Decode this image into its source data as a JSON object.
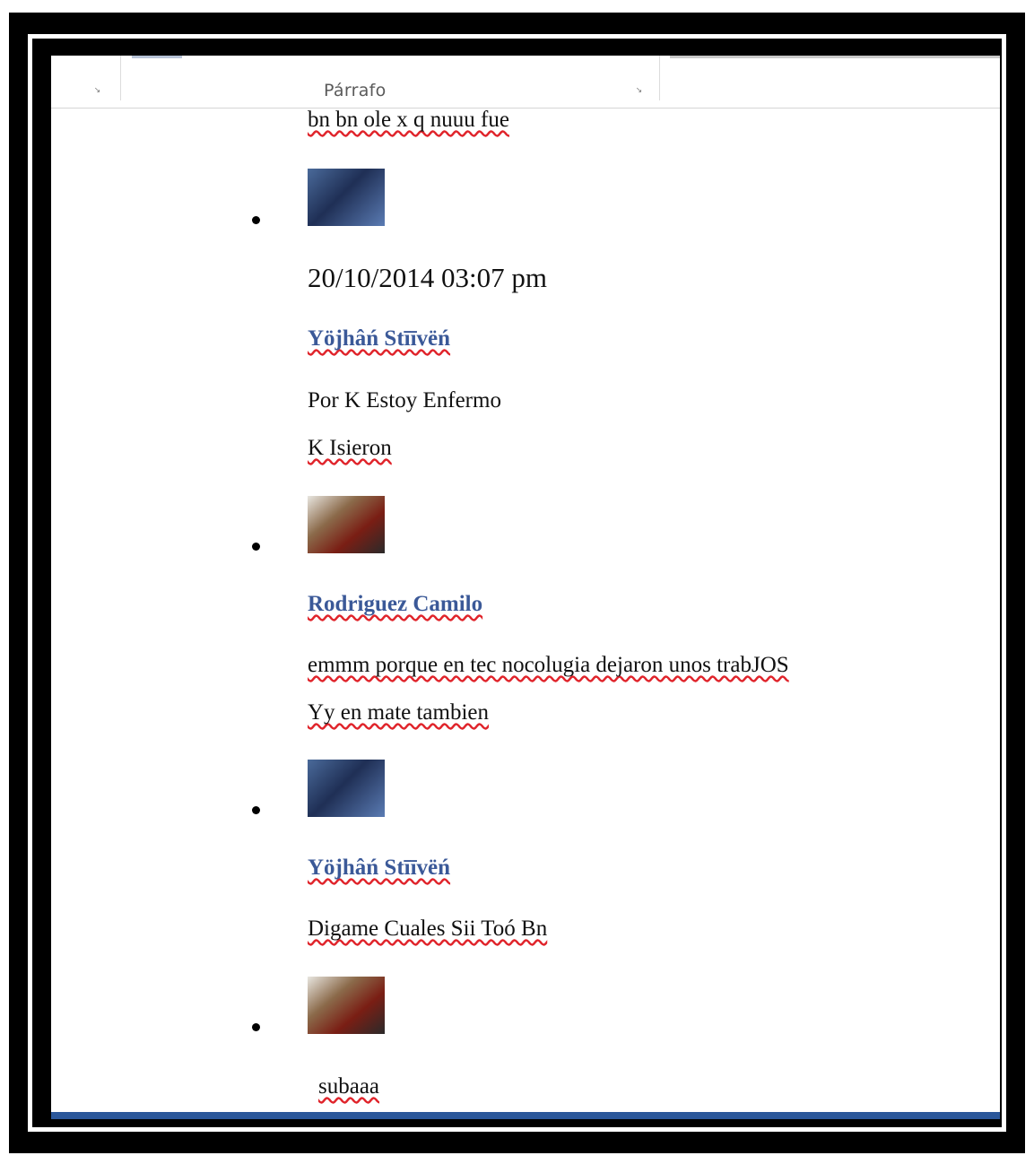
{
  "ribbon": {
    "group_label": "Párrafo"
  },
  "colors": {
    "name_link": "#3b5998",
    "spell_squiggle": "#e0242b",
    "status_bar": "#2b579a"
  },
  "comments": [
    {
      "text_lines": [
        "bn bn ole x q nuuu fue"
      ]
    },
    {
      "avatar": "user-photo-yojhan",
      "timestamp": "20/10/2014 03:07 pm",
      "author": "Yöjhâń Stīīvëń",
      "text_lines": [
        "Por K Estoy Enfermo",
        "K Isieron"
      ]
    },
    {
      "avatar": "user-photo-rodriguez",
      "author": "Rodriguez Camilo",
      "text_lines": [
        "emmm porque en tec nocolugia dejaron unos trabJOS",
        "Yy en mate tambien"
      ]
    },
    {
      "avatar": "user-photo-yojhan",
      "author": "Yöjhâń Stīīvëń",
      "text_lines": [
        "Digame Cuales Sii Toó Bn"
      ]
    },
    {
      "avatar": "user-photo-rodriguez",
      "text_lines": [
        "subaaa"
      ]
    }
  ]
}
